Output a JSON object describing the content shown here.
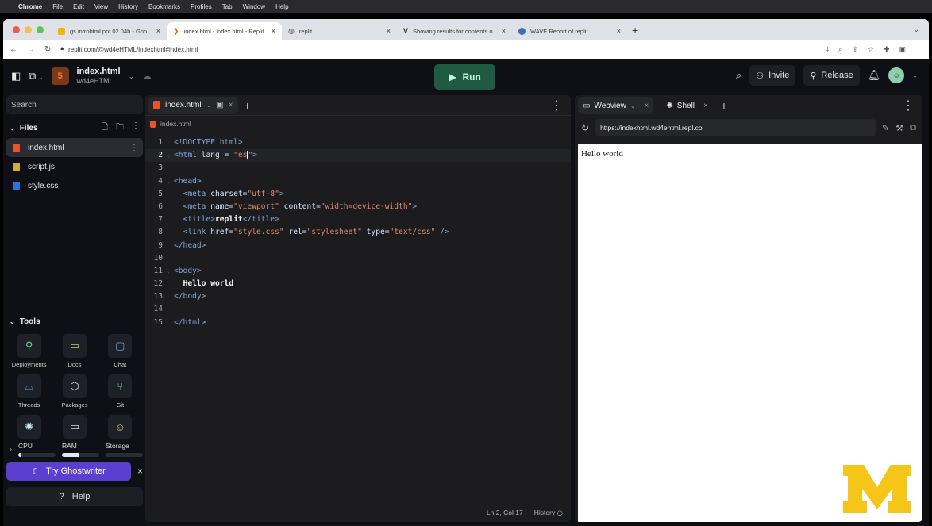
{
  "menubar": {
    "app": "Chrome",
    "items": [
      "File",
      "Edit",
      "View",
      "History",
      "Bookmarks",
      "Profiles",
      "Tab",
      "Window",
      "Help"
    ]
  },
  "browser": {
    "tabs": [
      {
        "title": "gs.introhtml.ppt.02.04b - Goo",
        "favicon": "slides-icon",
        "color": "#f4b400"
      },
      {
        "title": "index.html - index.html - Replit",
        "favicon": "replit-icon",
        "color": "#f26207",
        "active": true
      },
      {
        "title": "replit",
        "favicon": "globe-icon",
        "color": "#555555"
      },
      {
        "title": "Showing results for contents o",
        "favicon": "wave-icon",
        "color": "#333333"
      },
      {
        "title": "WAVE Report of replit",
        "favicon": "wave-report-icon",
        "color": "#3b6fb6"
      }
    ],
    "url": "replit.com/@wd4eHTML/indexhtml#index.html"
  },
  "topbar": {
    "file_name": "index.html",
    "user": "wd4eHTML",
    "run_label": "Run",
    "invite_label": "Invite",
    "release_label": "Release"
  },
  "sidebar": {
    "search_placeholder": "Search",
    "files_label": "Files",
    "files": [
      {
        "name": "index.html",
        "color": "#e4572e",
        "selected": true
      },
      {
        "name": "script.js",
        "color": "#c9b037"
      },
      {
        "name": "style.css",
        "color": "#2f6fdc"
      }
    ],
    "tools_label": "Tools",
    "tools": [
      {
        "label": "Deployments",
        "icon": "deployments-icon",
        "glyph": "⚲",
        "color": "#5fd38d"
      },
      {
        "label": "Docs",
        "icon": "docs-icon",
        "glyph": "▭",
        "color": "#c9c27a"
      },
      {
        "label": "Chat",
        "icon": "chat-icon",
        "glyph": "▢",
        "color": "#7d9be0"
      },
      {
        "label": "Threads",
        "icon": "threads-icon",
        "glyph": "⌓",
        "color": "#6fb0e6"
      },
      {
        "label": "Packages",
        "icon": "packages-icon",
        "glyph": "⬡",
        "color": "#dddddd"
      },
      {
        "label": "Git",
        "icon": "git-icon",
        "glyph": "⑂",
        "color": "#5fd38d"
      },
      {
        "label": "",
        "icon": "shell-icon",
        "glyph": "✺",
        "color": "#cfe6ee"
      },
      {
        "label": "",
        "icon": "monitor-icon",
        "glyph": "▭",
        "color": "#dddddd"
      },
      {
        "label": "",
        "icon": "user-icon",
        "glyph": "☺",
        "color": "#e6b57a"
      }
    ],
    "resources": [
      {
        "label": "CPU",
        "fraction": 0.08
      },
      {
        "label": "RAM",
        "fraction": 0.45
      },
      {
        "label": "Storage",
        "fraction": 0.0
      }
    ],
    "ghostwriter_label": "Try Ghostwriter",
    "help_label": "Help"
  },
  "editor": {
    "tab_label": "index.html",
    "breadcrumb": "index.html",
    "cursor": "Ln 2, Col 17",
    "history_label": "History"
  },
  "preview": {
    "tabs": [
      "Webview",
      "Shell"
    ],
    "url": "https://indexhtml.wd4ehtml.repl.co",
    "content": "Hello world"
  }
}
